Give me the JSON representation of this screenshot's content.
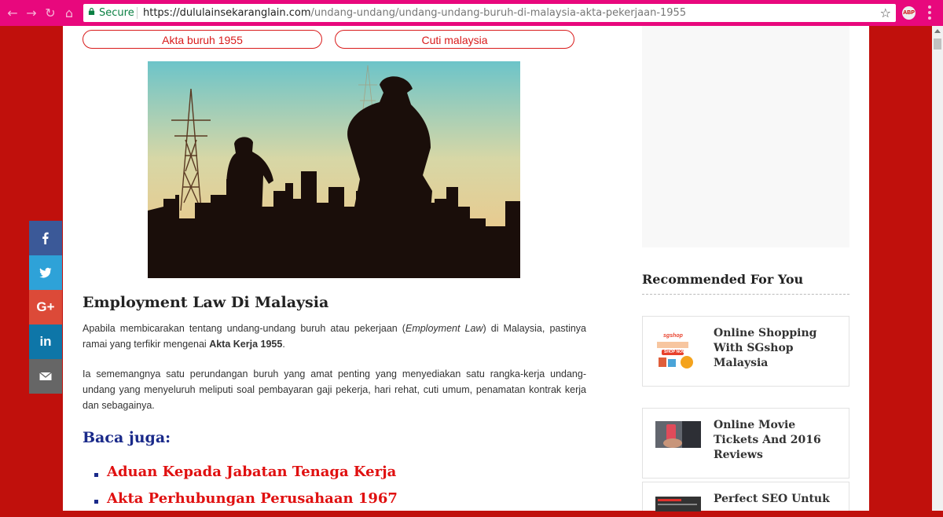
{
  "browser": {
    "secure_label": "Secure",
    "url_domain": "https://dululainsekaranglain.com",
    "url_path": "/undang-undang/undang-undang-buruh-di-malaysia-akta-pekerjaan-1955",
    "extension_label": "ABP",
    "nav_icons": [
      "back-icon",
      "forward-icon",
      "reload-icon",
      "home-icon"
    ]
  },
  "tags": [
    "Akta buruh 1955",
    "Cuti malaysia"
  ],
  "article": {
    "title": "Employment Law Di Malaysia",
    "para1_a": "Apabila membicarakan tentang undang-undang buruh atau pekerjaan (",
    "para1_em": "Employment Law",
    "para1_b": ") di Malaysia, pastinya ramai yang terfikir mengenai ",
    "para1_strong": "Akta Kerja 1955",
    "para1_c": ".",
    "para2": "Ia sememangnya satu perundangan buruh yang amat penting yang menyediakan satu rangka-kerja undang-undang yang menyeluruh meliputi soal pembayaran gaji pekerja, hari rehat, cuti umum, penamatan kontrak kerja dan sebagainya.",
    "baca_juga": "Baca juga:",
    "links": [
      "Aduan Kepada Jabatan Tenaga Kerja",
      "Akta Perhubungan Perusahaan 1967"
    ]
  },
  "sidebar": {
    "recommended_title": "Recommended For You",
    "cards": [
      {
        "title": "Online Shopping With SGshop Malaysia",
        "thumb_text_1": "sgshop",
        "thumb_text_2": "SHOP NOW"
      },
      {
        "title": "Online Movie Tickets And 2016 Reviews"
      },
      {
        "title": "Perfect SEO Untuk"
      }
    ]
  },
  "share": {
    "colors": {
      "facebook": "#3b5998",
      "twitter": "#2ea2d8",
      "google": "#dc4a38",
      "linkedin": "#0e76a8",
      "email": "#666666"
    },
    "gplus_label": "G+",
    "linkedin_label": "in"
  },
  "colors": {
    "accent": "#e01010",
    "chrome": "#e8087d",
    "background": "#c0100c",
    "heading_blue": "#1a2a8a"
  }
}
